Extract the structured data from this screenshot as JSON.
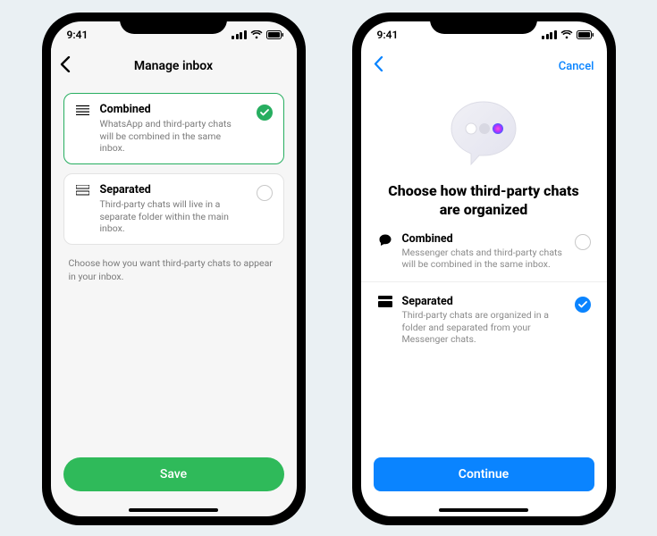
{
  "status": {
    "time": "9:41"
  },
  "phoneA": {
    "title": "Manage inbox",
    "options": [
      {
        "title": "Combined",
        "desc": "WhatsApp and third-party chats will be combined in the same inbox.",
        "selected": true
      },
      {
        "title": "Separated",
        "desc": "Third-party chats will live in a separate folder within the main inbox.",
        "selected": false
      }
    ],
    "footer": "Choose how you want third-party chats to appear in your inbox.",
    "save": "Save"
  },
  "phoneB": {
    "cancel": "Cancel",
    "heading": "Choose how third-party chats are organized",
    "options": [
      {
        "title": "Combined",
        "desc": "Messenger chats and third-party chats will be combined in the same inbox.",
        "selected": false
      },
      {
        "title": "Separated",
        "desc": "Third-party chats are organized in a folder and separated from your Messenger chats.",
        "selected": true
      }
    ],
    "continue": "Continue"
  },
  "colors": {
    "green": "#27ae60",
    "blue": "#0a84ff"
  }
}
